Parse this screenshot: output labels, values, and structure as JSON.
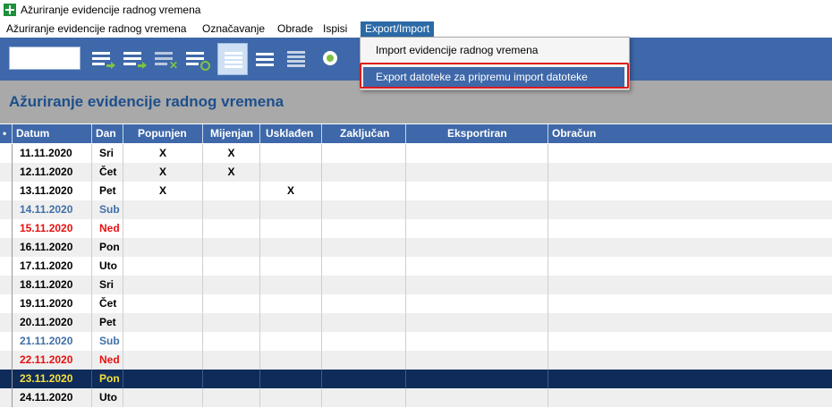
{
  "window": {
    "title": "Ažuriranje evidencije radnog vremena"
  },
  "menu": [
    {
      "label": "Ažuriranje evidencije radnog vremena"
    },
    {
      "label": "Označavanje"
    },
    {
      "label": "Obrade"
    },
    {
      "label": "Ispisi"
    },
    {
      "label": "Export/Import"
    }
  ],
  "dropdown": {
    "items": [
      {
        "label": "Import evidencije radnog vremena"
      },
      {
        "label": "Export datoteke za pripremu import datoteke"
      }
    ]
  },
  "page": {
    "title": "Ažuriranje evidencije radnog vremena"
  },
  "grid": {
    "columns": [
      "Datum",
      "Dan",
      "Popunjen",
      "Mijenjan",
      "Usklađen",
      "Zaključan",
      "Eksportiran",
      "Obračun"
    ],
    "rows": [
      {
        "date": "11.11.2020",
        "day": "Sri",
        "pop": "X",
        "mij": "X",
        "usk": "",
        "kind": "normal"
      },
      {
        "date": "12.11.2020",
        "day": "Čet",
        "pop": "X",
        "mij": "X",
        "usk": "",
        "kind": "normal"
      },
      {
        "date": "13.11.2020",
        "day": "Pet",
        "pop": "X",
        "mij": "",
        "usk": "X",
        "kind": "normal"
      },
      {
        "date": "14.11.2020",
        "day": "Sub",
        "pop": "",
        "mij": "",
        "usk": "",
        "kind": "saturday"
      },
      {
        "date": "15.11.2020",
        "day": "Ned",
        "pop": "",
        "mij": "",
        "usk": "",
        "kind": "sunday"
      },
      {
        "date": "16.11.2020",
        "day": "Pon",
        "pop": "",
        "mij": "",
        "usk": "",
        "kind": "normal"
      },
      {
        "date": "17.11.2020",
        "day": "Uto",
        "pop": "",
        "mij": "",
        "usk": "",
        "kind": "normal"
      },
      {
        "date": "18.11.2020",
        "day": "Sri",
        "pop": "",
        "mij": "",
        "usk": "",
        "kind": "normal"
      },
      {
        "date": "19.11.2020",
        "day": "Čet",
        "pop": "",
        "mij": "",
        "usk": "",
        "kind": "normal"
      },
      {
        "date": "20.11.2020",
        "day": "Pet",
        "pop": "",
        "mij": "",
        "usk": "",
        "kind": "normal"
      },
      {
        "date": "21.11.2020",
        "day": "Sub",
        "pop": "",
        "mij": "",
        "usk": "",
        "kind": "saturday"
      },
      {
        "date": "22.11.2020",
        "day": "Ned",
        "pop": "",
        "mij": "",
        "usk": "",
        "kind": "sunday"
      },
      {
        "date": "23.11.2020",
        "day": "Pon",
        "pop": "",
        "mij": "",
        "usk": "",
        "kind": "current"
      },
      {
        "date": "24.11.2020",
        "day": "Uto",
        "pop": "",
        "mij": "",
        "usk": "",
        "kind": "normal"
      }
    ]
  },
  "colors": {
    "toolbar": "#3e68a9",
    "saturday_text": "#3f6fa6",
    "sunday_text": "#e81010",
    "current_row_bg": "#0f2b5a",
    "current_row_text": "#f5e13a",
    "highlight_box": "#e01818"
  },
  "toolbar": {
    "icons": [
      "list-arrow-right-icon",
      "list-arrow-right-icon",
      "list-delete-icon",
      "list-refresh-icon",
      "lines-view-icon",
      "lines-view-icon",
      "lines-view-icon",
      "record-circle-icon"
    ]
  }
}
